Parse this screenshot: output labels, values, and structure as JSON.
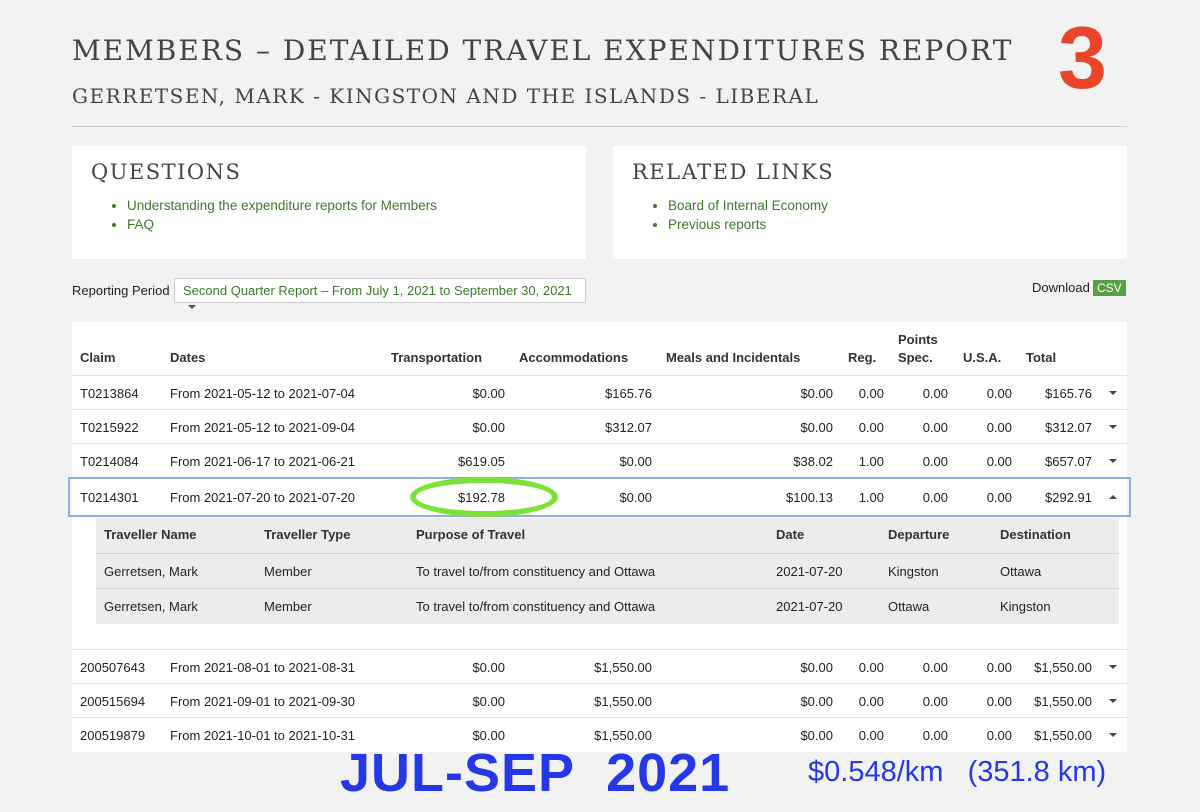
{
  "header": {
    "title": "MEMBERS – DETAILED TRAVEL EXPENDITURES REPORT",
    "subtitle": "GERRETSEN, MARK - KINGSTON AND THE ISLANDS - LIBERAL",
    "overlay_number": "3"
  },
  "questions": {
    "title": "QUESTIONS",
    "links": [
      "Understanding the expenditure reports for Members",
      "FAQ"
    ]
  },
  "related": {
    "title": "RELATED LINKS",
    "links": [
      "Board of Internal Economy",
      "Previous reports"
    ]
  },
  "reporting": {
    "label": "Reporting Period",
    "selected": "Second Quarter Report – From July 1, 2021 to September 30, 2021"
  },
  "download": {
    "label": "Download",
    "badge": "CSV"
  },
  "table": {
    "headers": {
      "claim": "Claim",
      "dates": "Dates",
      "transportation": "Transportation",
      "accommodations": "Accommodations",
      "meals": "Meals and Incidentals",
      "reg": "Reg.",
      "points1": "Points",
      "points2": "Spec.",
      "usa": "U.S.A.",
      "total": "Total"
    },
    "rows": [
      {
        "claim": "T0213864",
        "dates": "From 2021-05-12 to 2021-07-04",
        "transportation": "$0.00",
        "accommodations": "$165.76",
        "meals": "$0.00",
        "reg": "0.00",
        "spec": "0.00",
        "usa": "0.00",
        "total": "$165.76"
      },
      {
        "claim": "T0215922",
        "dates": "From 2021-05-12 to 2021-09-04",
        "transportation": "$0.00",
        "accommodations": "$312.07",
        "meals": "$0.00",
        "reg": "0.00",
        "spec": "0.00",
        "usa": "0.00",
        "total": "$312.07"
      },
      {
        "claim": "T0214084",
        "dates": "From 2021-06-17 to 2021-06-21",
        "transportation": "$619.05",
        "accommodations": "$0.00",
        "meals": "$38.02",
        "reg": "1.00",
        "spec": "0.00",
        "usa": "0.00",
        "total": "$657.07"
      },
      {
        "claim": "T0214301",
        "dates": "From 2021-07-20 to 2021-07-20",
        "transportation": "$192.78",
        "accommodations": "$0.00",
        "meals": "$100.13",
        "reg": "1.00",
        "spec": "0.00",
        "usa": "0.00",
        "total": "$292.91"
      },
      {
        "claim": "200507643",
        "dates": "From 2021-08-01 to 2021-08-31",
        "transportation": "$0.00",
        "accommodations": "$1,550.00",
        "meals": "$0.00",
        "reg": "0.00",
        "spec": "0.00",
        "usa": "0.00",
        "total": "$1,550.00"
      },
      {
        "claim": "200515694",
        "dates": "From 2021-09-01 to 2021-09-30",
        "transportation": "$0.00",
        "accommodations": "$1,550.00",
        "meals": "$0.00",
        "reg": "0.00",
        "spec": "0.00",
        "usa": "0.00",
        "total": "$1,550.00"
      },
      {
        "claim": "200519879",
        "dates": "From 2021-10-01 to 2021-10-31",
        "transportation": "$0.00",
        "accommodations": "$1,550.00",
        "meals": "$0.00",
        "reg": "0.00",
        "spec": "0.00",
        "usa": "0.00",
        "total": "$1,550.00"
      }
    ]
  },
  "detail": {
    "headers": {
      "name": "Traveller Name",
      "type": "Traveller Type",
      "purpose": "Purpose of Travel",
      "date": "Date",
      "departure": "Departure",
      "destination": "Destination"
    },
    "rows": [
      {
        "name": "Gerretsen, Mark",
        "type": "Member",
        "purpose": "To travel to/from constituency and Ottawa",
        "date": "2021-07-20",
        "departure": "Kingston",
        "destination": "Ottawa"
      },
      {
        "name": "Gerretsen, Mark",
        "type": "Member",
        "purpose": "To travel to/from constituency and Ottawa",
        "date": "2021-07-20",
        "departure": "Ottawa",
        "destination": "Kingston"
      }
    ]
  },
  "annotations": {
    "period": "JUL-SEP  2021",
    "rate": "$0.548/km   (351.8 km)",
    "ring_color": "#7be23a",
    "text_color": "#2538e8"
  }
}
